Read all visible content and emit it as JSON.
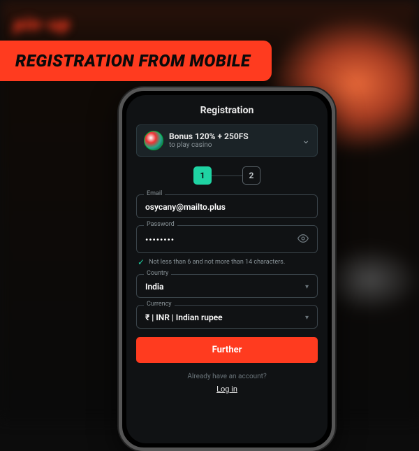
{
  "banner": {
    "label": "REGISTRATION FROM MOBILE"
  },
  "bg": {
    "logo": "pin-up"
  },
  "screen": {
    "title": "Registration",
    "bonus": {
      "title": "Bonus 120% + 250FS",
      "sub": "to play casino"
    },
    "steps": {
      "one": "1",
      "two": "2"
    },
    "email": {
      "label": "Email",
      "value": "osycany@mailto.plus"
    },
    "password": {
      "label": "Password",
      "value": "••••••••"
    },
    "hint": "Not less than 6 and not more than 14 characters.",
    "country": {
      "label": "Country",
      "value": "India"
    },
    "currency": {
      "label": "Currency",
      "value": "₹ | INR | Indian rupee"
    },
    "further": "Further",
    "already": "Already have an account?",
    "login": "Log in"
  }
}
